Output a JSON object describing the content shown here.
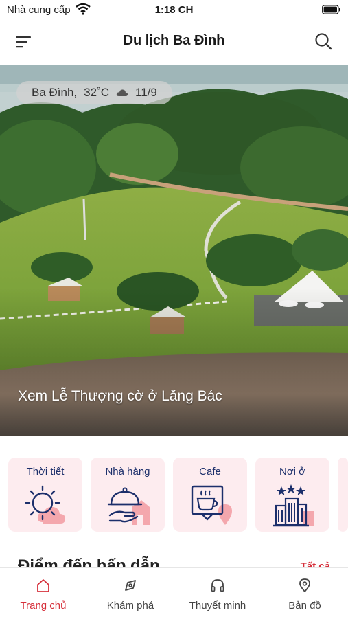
{
  "status_bar": {
    "carrier": "Nhà cung cấp",
    "time": "1:18 CH"
  },
  "header": {
    "title": "Du lịch Ba Đình"
  },
  "hero": {
    "weather": {
      "location": "Ba Đình,",
      "temperature": "32˚C",
      "date": "11/9"
    },
    "caption": "Xem Lễ Thượng cờ ở Lăng Bác"
  },
  "categories": [
    {
      "label": "Thời tiết",
      "icon": "weather-icon"
    },
    {
      "label": "Nhà hàng",
      "icon": "restaurant-icon"
    },
    {
      "label": "Cafe",
      "icon": "cafe-icon"
    },
    {
      "label": "Nơi ở",
      "icon": "hotel-icon"
    }
  ],
  "featured": {
    "title": "Điểm đến hấp dẫn",
    "see_all": "Tất cả"
  },
  "tabs": [
    {
      "label": "Trang chủ",
      "icon": "home-icon",
      "active": true
    },
    {
      "label": "Khám phá",
      "icon": "explore-icon",
      "active": false
    },
    {
      "label": "Thuyết minh",
      "icon": "headphones-icon",
      "active": false
    },
    {
      "label": "Bản đồ",
      "icon": "map-pin-icon",
      "active": false
    }
  ],
  "colors": {
    "accent": "#d6303b",
    "category_bg": "#fdecef",
    "icon_navy": "#1c2f6b",
    "icon_pink": "#f4a7ad"
  }
}
